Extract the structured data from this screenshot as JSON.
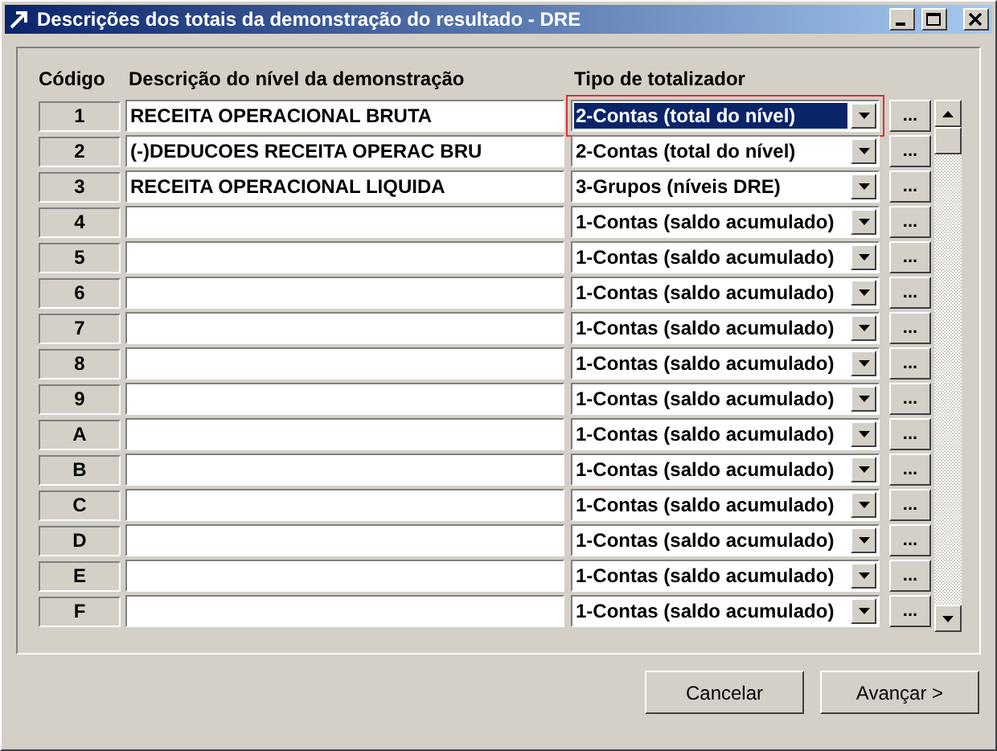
{
  "window": {
    "title": "Descrições dos totais da demonstração do resultado - DRE"
  },
  "columns": [
    "Código",
    "Descrição do nível da demonstração",
    "Tipo de totalizador"
  ],
  "rows": [
    {
      "code": "1",
      "description": "RECEITA OPERACIONAL BRUTA",
      "type": "2-Contas (total do nível)",
      "button": "...",
      "focused": true
    },
    {
      "code": "2",
      "description": "(-)DEDUCOES RECEITA OPERAC BRU",
      "type": "2-Contas (total do nível)",
      "button": "...",
      "focused": false
    },
    {
      "code": "3",
      "description": "RECEITA OPERACIONAL LIQUIDA",
      "type": "3-Grupos (níveis DRE)",
      "button": "...",
      "focused": false
    },
    {
      "code": "4",
      "type": "1-Contas (saldo acumulado)",
      "button": "...",
      "focused": false
    },
    {
      "code": "5",
      "type": "1-Contas (saldo acumulado)",
      "button": "...",
      "focused": false
    },
    {
      "code": "6",
      "type": "1-Contas (saldo acumulado)",
      "button": "...",
      "focused": false
    },
    {
      "code": "7",
      "type": "1-Contas (saldo acumulado)",
      "button": "...",
      "focused": false
    },
    {
      "code": "8",
      "type": "1-Contas (saldo acumulado)",
      "button": "...",
      "focused": false
    },
    {
      "code": "9",
      "type": "1-Contas (saldo acumulado)",
      "button": "...",
      "focused": false
    },
    {
      "code": "A",
      "type": "1-Contas (saldo acumulado)",
      "button": "...",
      "focused": false
    },
    {
      "code": "B",
      "type": "1-Contas (saldo acumulado)",
      "button": "...",
      "focused": false
    },
    {
      "code": "C",
      "type": "1-Contas (saldo acumulado)",
      "button": "...",
      "focused": false
    },
    {
      "code": "D",
      "type": "1-Contas (saldo acumulado)",
      "button": "...",
      "focused": false
    },
    {
      "code": "E",
      "type": "1-Contas (saldo acumulado)",
      "button": "...",
      "focused": false
    },
    {
      "code": "F",
      "type": "1-Contas (saldo acumulado)",
      "button": "...",
      "focused": false
    }
  ],
  "buttons": [
    "Cancelar",
    "Avançar >"
  ]
}
